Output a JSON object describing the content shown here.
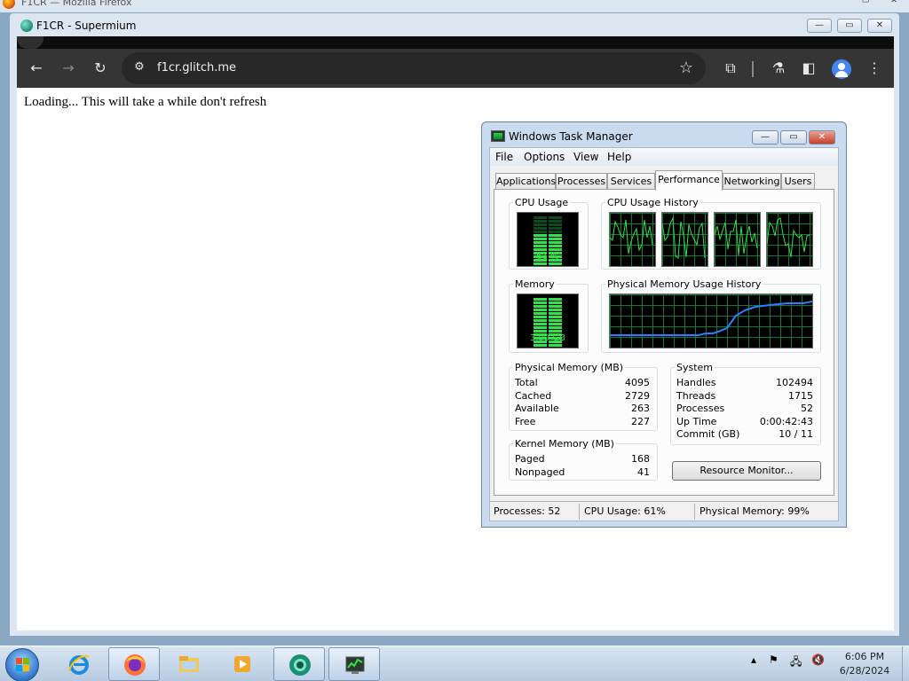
{
  "background_window": {
    "title": "F1CR — Mozilla Firefox"
  },
  "window": {
    "title": "F1CR - Supermium",
    "controls": {
      "minimize": "—",
      "maximize": "▭",
      "close": "✕"
    }
  },
  "browser": {
    "url": "f1cr.glitch.me",
    "icons": [
      "back-arrow-icon",
      "forward-arrow-icon",
      "reload-icon",
      "site-info-icon",
      "bookmark-star-icon",
      "extensions-icon",
      "labs-icon",
      "sidebar-icon",
      "profile-icon",
      "menu-icon"
    ]
  },
  "page": {
    "loading_text": "Loading... This will take a while don't refresh"
  },
  "task_manager": {
    "title": "Windows Task Manager",
    "menu": [
      "File",
      "Options",
      "View",
      "Help"
    ],
    "tabs": [
      "Applications",
      "Processes",
      "Services",
      "Performance",
      "Networking",
      "Users"
    ],
    "active_tab": "Performance",
    "cpu_usage": {
      "label": "CPU Usage",
      "value": "61 %",
      "level": 0.61
    },
    "cpu_history": {
      "label": "CPU Usage History",
      "cores": 4
    },
    "memory": {
      "label": "Memory",
      "value": "3.99 GB",
      "level": 0.99
    },
    "memory_history": {
      "label": "Physical Memory Usage History"
    },
    "physical_memory": {
      "label": "Physical Memory (MB)",
      "rows": [
        {
          "name": "Total",
          "value": "4095"
        },
        {
          "name": "Cached",
          "value": "2729"
        },
        {
          "name": "Available",
          "value": "263"
        },
        {
          "name": "Free",
          "value": "227"
        }
      ]
    },
    "kernel_memory": {
      "label": "Kernel Memory (MB)",
      "rows": [
        {
          "name": "Paged",
          "value": "168"
        },
        {
          "name": "Nonpaged",
          "value": "41"
        }
      ]
    },
    "system": {
      "label": "System",
      "rows": [
        {
          "name": "Handles",
          "value": "102494"
        },
        {
          "name": "Threads",
          "value": "1715"
        },
        {
          "name": "Processes",
          "value": "52"
        },
        {
          "name": "Up Time",
          "value": "0:00:42:43"
        },
        {
          "name": "Commit (GB)",
          "value": "10 / 11"
        }
      ]
    },
    "resource_monitor_button": "Resource Monitor...",
    "status": {
      "processes": "Processes: 52",
      "cpu": "CPU Usage: 61%",
      "memory": "Physical Memory: 99%"
    }
  },
  "taskbar": {
    "items": [
      "internet-explorer",
      "firefox",
      "file-explorer",
      "media-player",
      "supermium",
      "task-manager"
    ],
    "clock": {
      "time": "6:06 PM",
      "date": "6/28/2024"
    }
  },
  "colors": {
    "graph_green": "#32e04a",
    "graph_grid": "#0f7a3a",
    "memory_line": "#2b7fff"
  }
}
